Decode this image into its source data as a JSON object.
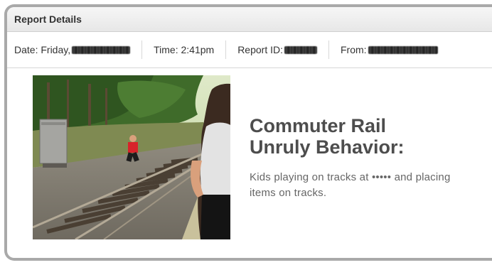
{
  "report": {
    "header_title": "Report Details",
    "date_label": "Date: Friday,",
    "time_label": "Time: 2:41pm",
    "report_id_label": "Report ID:",
    "from_label": "From:"
  },
  "story": {
    "title_line1": "Commuter Rail",
    "title_line2": "Unruly Behavior:",
    "description": "Kids playing on tracks at ••••• and placing items on tracks."
  },
  "colors": {
    "frame_border": "#a9a9a9",
    "title_text": "#4d4d4d",
    "body_text": "#666666"
  }
}
